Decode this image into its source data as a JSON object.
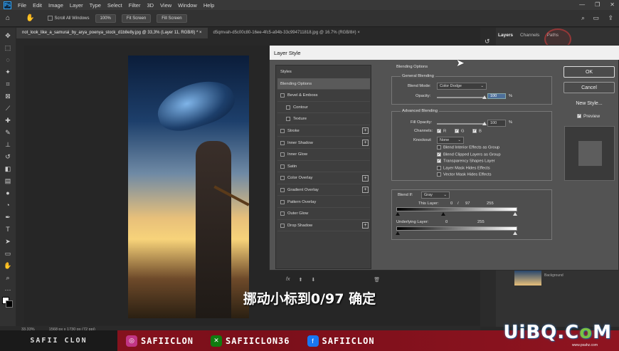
{
  "app": {
    "logo": "Ps"
  },
  "menu": [
    "File",
    "Edit",
    "Image",
    "Layer",
    "Type",
    "Select",
    "Filter",
    "3D",
    "View",
    "Window",
    "Help"
  ],
  "window_controls": [
    "—",
    "❐",
    "✕"
  ],
  "options_bar": {
    "scroll_all_label": "Scroll All Windows",
    "zoom_value": "100%",
    "fit_screen": "Fit Screen",
    "fill_screen": "Fill Screen"
  },
  "doc_tabs": [
    {
      "label": "not_look_like_a_samurai_by_arya_poenya_stock_d1b8e8y.jpg @ 33,3% (Layer 11, RGB/8) *",
      "close": "×"
    },
    {
      "label": "d5qmvah-d5c00c80-16ee-4fc5-a94b-33c994711818.jpg @ 16.7% (RGB/8#)",
      "close": "×"
    }
  ],
  "panel_tabs": [
    "Layers",
    "Channels",
    "Paths"
  ],
  "status": {
    "zoom": "33,33%",
    "doc_size": "1568 px x 1730 px (72 ppi)"
  },
  "layer_thumb_label": "Background",
  "dialog": {
    "title": "Layer Style",
    "styles_header": "Styles",
    "styles": [
      {
        "label": "Blending Options",
        "selected": true,
        "checkbox": false,
        "plus": false,
        "indent": false
      },
      {
        "label": "Bevel & Emboss",
        "checkbox": true,
        "plus": false,
        "indent": false
      },
      {
        "label": "Contour",
        "checkbox": true,
        "plus": false,
        "indent": true
      },
      {
        "label": "Texture",
        "checkbox": true,
        "plus": false,
        "indent": true
      },
      {
        "label": "Stroke",
        "checkbox": true,
        "plus": true,
        "indent": false
      },
      {
        "label": "Inner Shadow",
        "checkbox": true,
        "plus": true,
        "indent": false
      },
      {
        "label": "Inner Glow",
        "checkbox": true,
        "plus": false,
        "indent": false
      },
      {
        "label": "Satin",
        "checkbox": true,
        "plus": false,
        "indent": false
      },
      {
        "label": "Color Overlay",
        "checkbox": true,
        "plus": true,
        "indent": false
      },
      {
        "label": "Gradient Overlay",
        "checkbox": true,
        "plus": true,
        "indent": false
      },
      {
        "label": "Pattern Overlay",
        "checkbox": true,
        "plus": false,
        "indent": false
      },
      {
        "label": "Outer Glow",
        "checkbox": true,
        "plus": false,
        "indent": false
      },
      {
        "label": "Drop Shadow",
        "checkbox": true,
        "plus": true,
        "indent": false
      }
    ],
    "fx_label": "fx",
    "blending_options": "Blending Options",
    "general_blending": "General Blending",
    "blend_mode_label": "Blend Mode:",
    "blend_mode_value": "Color Dodge",
    "opacity_label": "Opacity:",
    "opacity_value": "100",
    "pct": "%",
    "advanced_blending": "Advanced Blending",
    "fill_opacity_label": "Fill Opacity:",
    "fill_opacity_value": "100",
    "channels_label": "Channels:",
    "channels": [
      "R",
      "G",
      "B"
    ],
    "knockout_label": "Knockout:",
    "knockout_value": "None",
    "checks": [
      {
        "label": "Blend Interior Effects as Group",
        "checked": false
      },
      {
        "label": "Blend Clipped Layers as Group",
        "checked": true
      },
      {
        "label": "Transparency Shapes Layer",
        "checked": true
      },
      {
        "label": "Layer Mask Hides Effects",
        "checked": false
      },
      {
        "label": "Vector Mask Hides Effects",
        "checked": false
      }
    ],
    "blend_if_label": "Blend If:",
    "blend_if_value": "Gray",
    "this_layer_label": "This Layer:",
    "this_layer_values": [
      "0",
      "/",
      "97",
      "255"
    ],
    "underlying_label": "Underlying Layer:",
    "underlying_values": [
      "0",
      "255"
    ],
    "buttons": {
      "ok": "OK",
      "cancel": "Cancel",
      "new_style": "New Style...",
      "preview": "Preview"
    },
    "preview_checked": true
  },
  "subtitle": "挪动小标到0/97 确定",
  "banner": {
    "name": "SAFII CLON",
    "socials": [
      {
        "icon": "instagram-icon",
        "handle": "SAFIICLON",
        "color": "#c13584"
      },
      {
        "icon": "xbox-icon",
        "handle": "SAFIICLON36",
        "color": "#107c10"
      },
      {
        "icon": "facebook-icon",
        "handle": "SAFIICLON",
        "color": "#1877f2"
      }
    ]
  },
  "watermark": {
    "text_a": "UiBQ.C",
    "text_o": "o",
    "text_b": "M",
    "sub": "www.psahz.com"
  }
}
